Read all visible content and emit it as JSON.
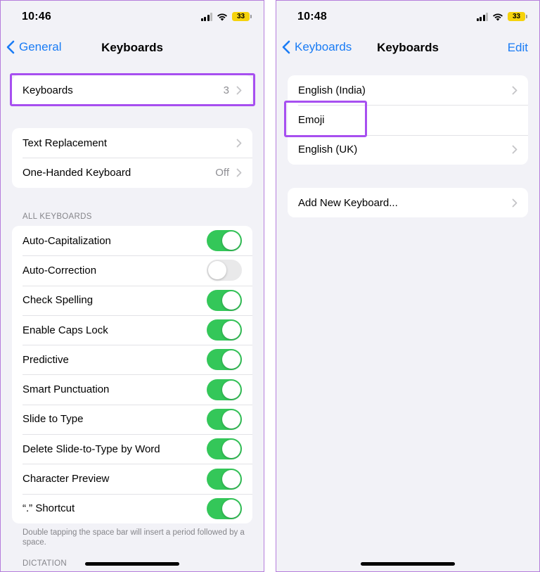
{
  "colors": {
    "accent": "#1a7cf5",
    "toggle_on": "#34c759",
    "highlight": "#a74ff0",
    "battery": "#f5d20c"
  },
  "left": {
    "status": {
      "time": "10:46",
      "battery": "33"
    },
    "nav": {
      "back_label": "General",
      "title": "Keyboards"
    },
    "keyboards_row": {
      "label": "Keyboards",
      "value": "3"
    },
    "text_group": [
      {
        "label": "Text Replacement",
        "value": ""
      },
      {
        "label": "One-Handed Keyboard",
        "value": "Off"
      }
    ],
    "all_keyboards_header": "ALL KEYBOARDS",
    "toggles": [
      {
        "label": "Auto-Capitalization",
        "on": true
      },
      {
        "label": "Auto-Correction",
        "on": false
      },
      {
        "label": "Check Spelling",
        "on": true
      },
      {
        "label": "Enable Caps Lock",
        "on": true
      },
      {
        "label": "Predictive",
        "on": true
      },
      {
        "label": "Smart Punctuation",
        "on": true
      },
      {
        "label": "Slide to Type",
        "on": true
      },
      {
        "label": "Delete Slide-to-Type by Word",
        "on": true
      },
      {
        "label": "Character Preview",
        "on": true
      },
      {
        "label": "“.” Shortcut",
        "on": true
      }
    ],
    "shortcut_footer": "Double tapping the space bar will insert a period followed by a space.",
    "dictation_header": "DICTATION"
  },
  "right": {
    "status": {
      "time": "10:48",
      "battery": "33"
    },
    "nav": {
      "back_label": "Keyboards",
      "title": "Keyboards",
      "edit_label": "Edit"
    },
    "keyboards": [
      {
        "label": "English (India)",
        "chevron": true
      },
      {
        "label": "Emoji",
        "chevron": false
      },
      {
        "label": "English (UK)",
        "chevron": true
      }
    ],
    "add_keyboard": "Add New Keyboard..."
  }
}
